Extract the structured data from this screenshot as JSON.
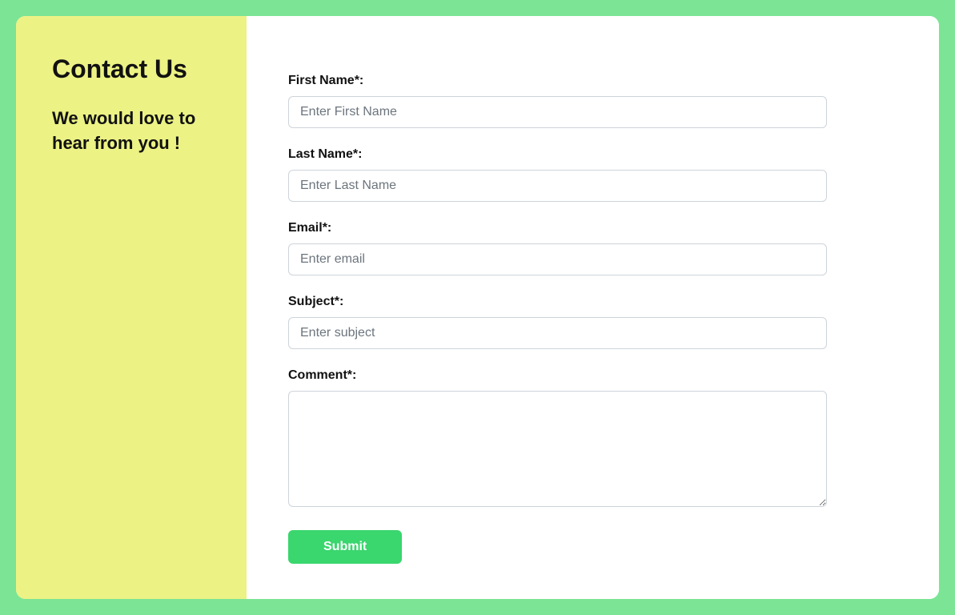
{
  "sidebar": {
    "title": "Contact Us",
    "subtitle": "We would love to hear from you !"
  },
  "form": {
    "firstName": {
      "label": "First Name*:",
      "placeholder": "Enter First Name",
      "value": ""
    },
    "lastName": {
      "label": "Last Name*:",
      "placeholder": "Enter Last Name",
      "value": ""
    },
    "email": {
      "label": "Email*:",
      "placeholder": "Enter email",
      "value": ""
    },
    "subject": {
      "label": "Subject*:",
      "placeholder": "Enter subject",
      "value": ""
    },
    "comment": {
      "label": "Comment*:",
      "placeholder": "",
      "value": ""
    },
    "submit": {
      "label": "Submit"
    }
  }
}
